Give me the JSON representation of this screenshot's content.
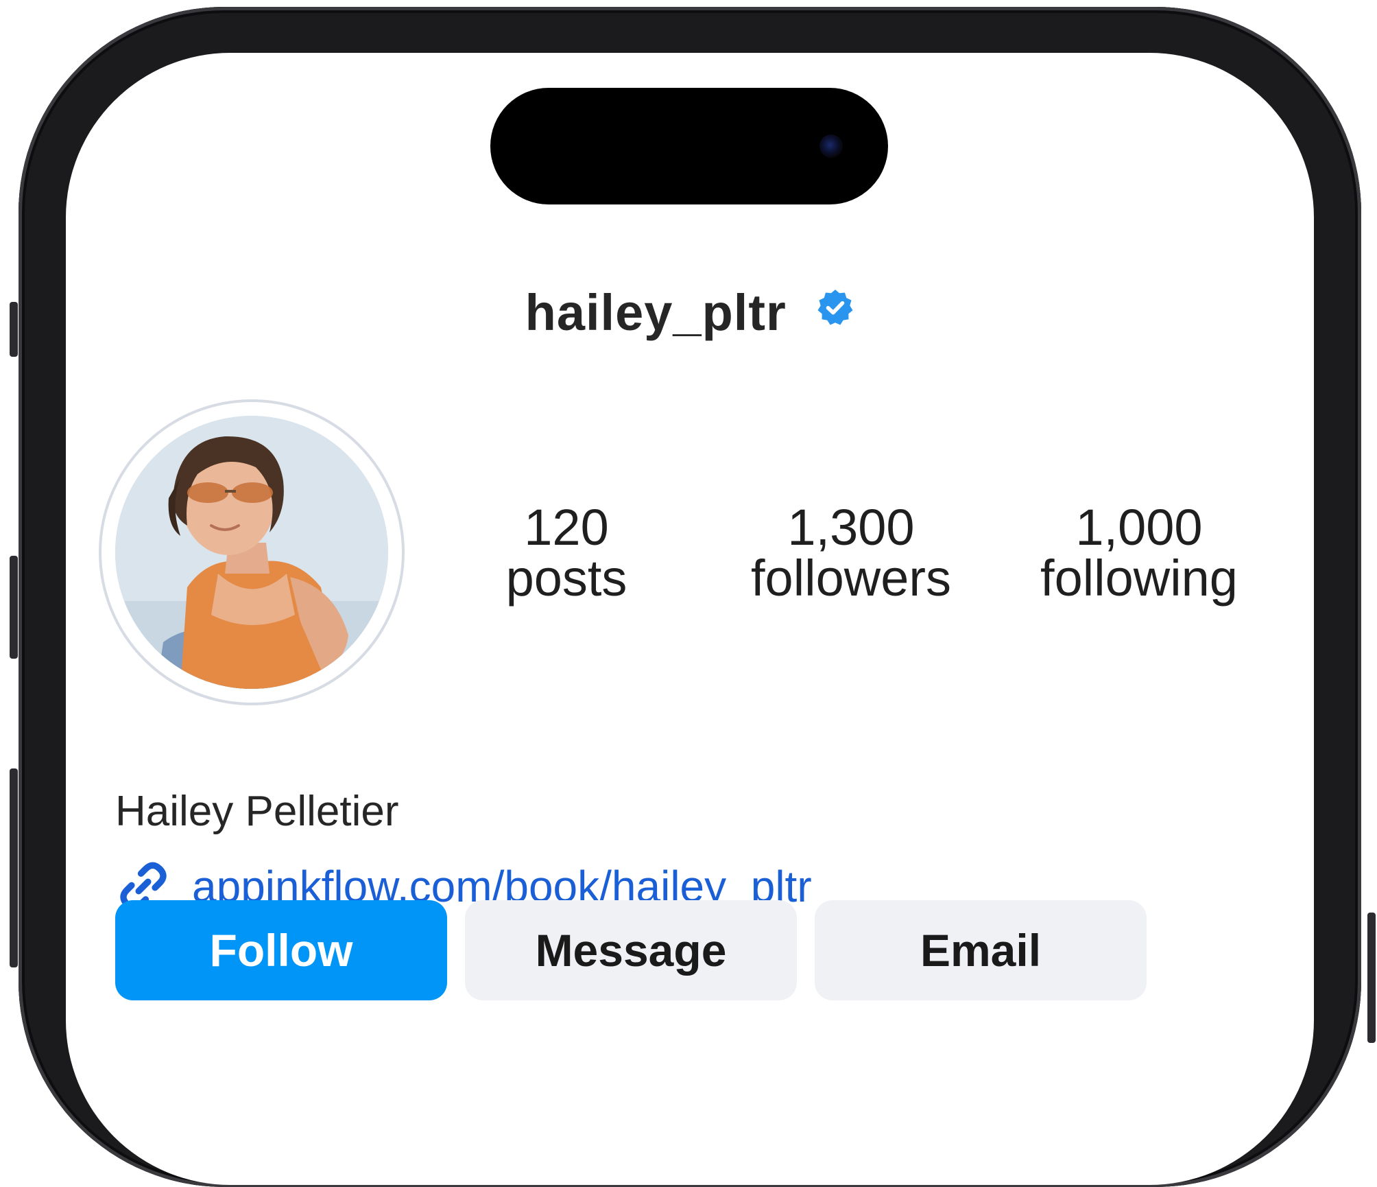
{
  "profile": {
    "username": "hailey_pltr",
    "full_name": "Hailey Pelletier",
    "link": "appinkflow.com/book/hailey_pltr",
    "verified": true
  },
  "stats": [
    {
      "value": "120",
      "label": "posts"
    },
    {
      "value": "1,300",
      "label": "followers"
    },
    {
      "value": "1,000",
      "label": "following"
    }
  ],
  "actions": {
    "follow_label": "Follow",
    "message_label": "Message",
    "email_label": "Email"
  },
  "colors": {
    "accent": "#0095f6",
    "link": "#1a5fd6",
    "secondary_button": "#eff1f4",
    "text": "#262626"
  },
  "icons": {
    "verified": "verified-badge-icon",
    "link": "link-icon",
    "camera": "camera-icon"
  }
}
